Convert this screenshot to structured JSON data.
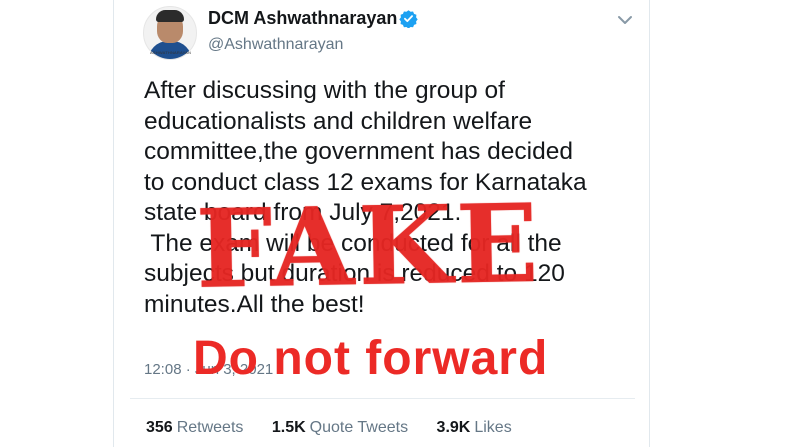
{
  "tweet": {
    "display_name": "DCM Ashwathnarayan",
    "handle": "@Ashwathnarayan",
    "avatar_caption": "ASHWATHNARAYAN",
    "text_lines": [
      "After discussing with the group of",
      "educationalists and children welfare",
      "committee,the government has decided",
      "to conduct class 12 exams for Karnataka",
      "state board from July 7,2021.",
      " The exam will be conducted for all the",
      "subjects but duration is reduced to 120",
      "minutes.All the best!"
    ],
    "timestamp": "12:08 · Jun 3, 2021",
    "stats": [
      {
        "number": "356",
        "label": "Retweets"
      },
      {
        "number": "1.5K",
        "label": "Quote Tweets"
      },
      {
        "number": "3.9K",
        "label": "Likes"
      }
    ]
  },
  "overlay": {
    "fake_stamp": "FAKE",
    "warning": "Do not forward"
  },
  "icons": {
    "verified": "verified-badge-icon",
    "menu": "chevron-down-icon"
  },
  "colors": {
    "text": "#14171a",
    "secondary": "#657786",
    "verified": "#1da1f2",
    "stamp_red": "#e42622"
  }
}
